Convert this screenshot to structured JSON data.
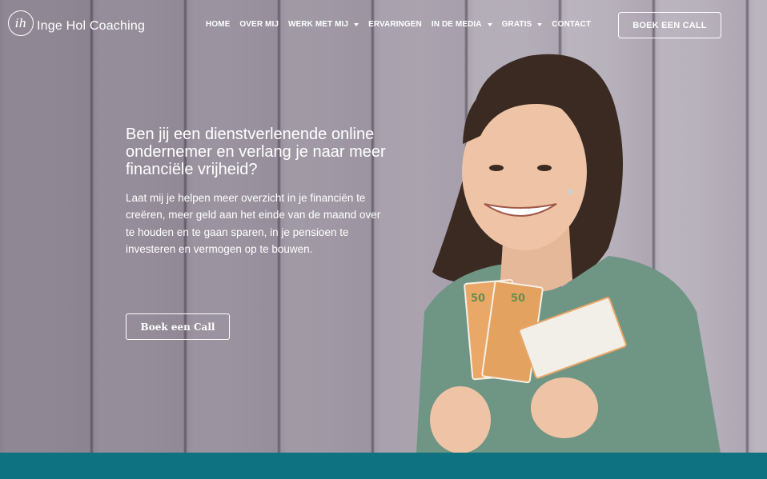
{
  "brand": {
    "logo_mark": "ih",
    "name": "Inge Hol Coaching"
  },
  "nav": {
    "items": [
      {
        "label": "HOME",
        "has_dropdown": false
      },
      {
        "label": "OVER MIJ",
        "has_dropdown": false
      },
      {
        "label": "WERK MET MIJ",
        "has_dropdown": true
      },
      {
        "label": "ERVARINGEN",
        "has_dropdown": false
      },
      {
        "label": "IN DE MEDIA",
        "has_dropdown": true
      },
      {
        "label": "GRATIS",
        "has_dropdown": true
      },
      {
        "label": "CONTACT",
        "has_dropdown": false
      }
    ],
    "cta_label": "Boek een Call"
  },
  "hero": {
    "headline": "Ben jij een dienstverlenende online ondernemer en verlang je naar meer financiële vrijheid?",
    "body": "Laat mij je helpen meer overzicht in je financiën te creëren, meer geld aan het einde van de maand over te houden en te gaan sparen, in je pensioen te investeren en vermogen op te bouwen.",
    "cta_label": "Boek een Call"
  },
  "colors": {
    "footer_band": "#0e7280",
    "text": "#ffffff"
  }
}
